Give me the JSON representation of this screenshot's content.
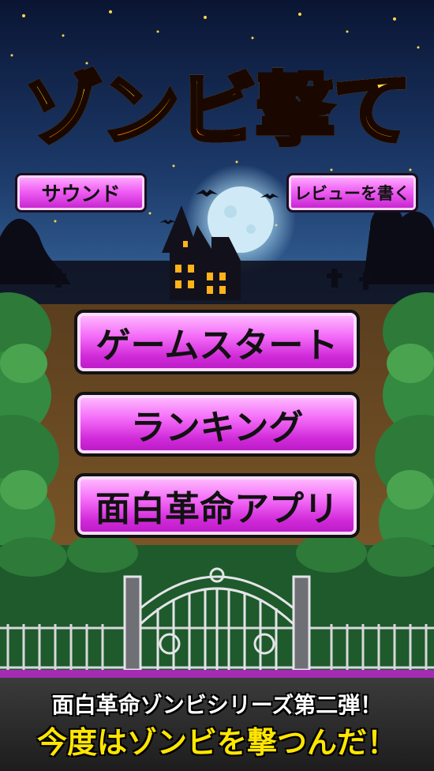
{
  "app": {
    "title": "ゾンビ撃て"
  },
  "top_buttons": {
    "sound_label": "サウンド",
    "review_label": "レビューを書く"
  },
  "menu": {
    "start_label": "ゲームスタート",
    "ranking_label": "ランキング",
    "apps_label": "面白革命アプリ"
  },
  "footer": {
    "line1": "面白革命ゾンビシリーズ第二弾！",
    "line2": "今度はゾンビを撃つんだ！"
  },
  "colors": {
    "sky_top": "#0a1533",
    "sky_bottom": "#2a5a8f",
    "moon": "#cfeaf6",
    "button_magenta": "#e040ea",
    "path_brown": "#6a4a22",
    "bush_green": "#2e7a3a",
    "footer_bg": "#2a2a2a",
    "footer_stripe": "#a52bb5",
    "accent_yellow": "#ffe600"
  }
}
